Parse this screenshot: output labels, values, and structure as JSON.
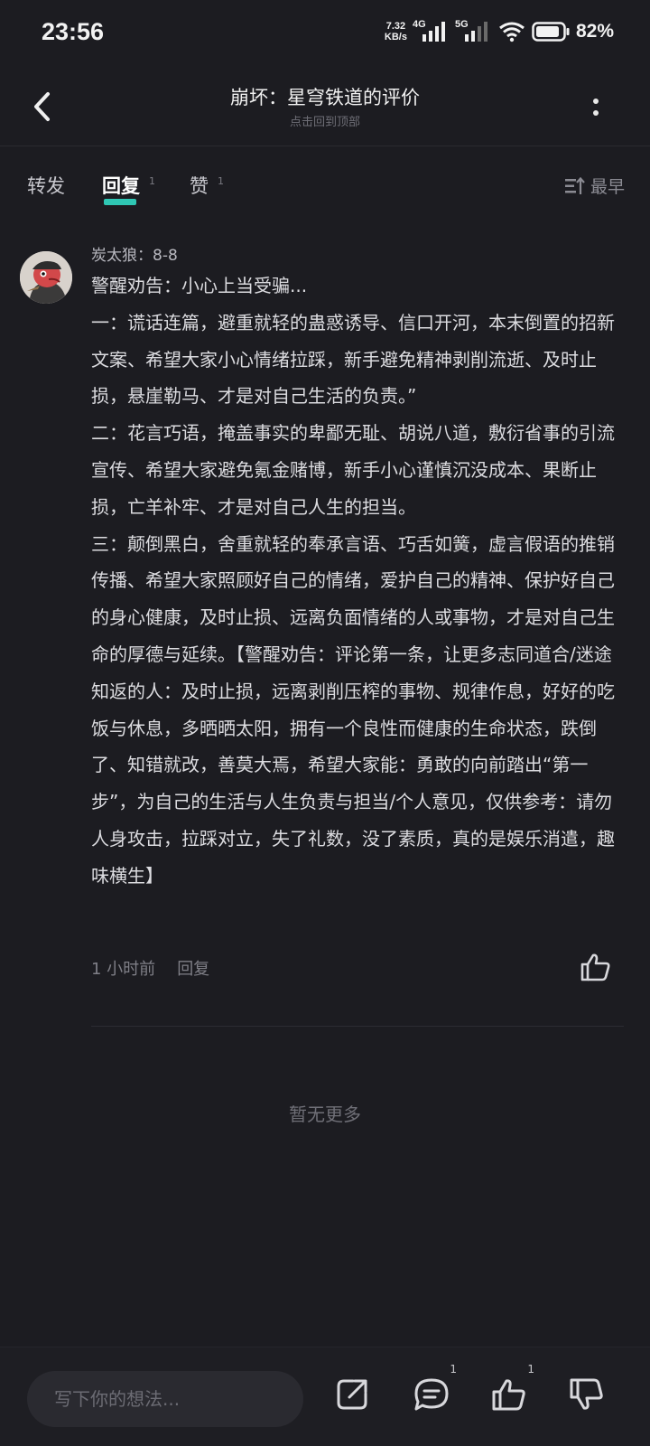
{
  "status_bar": {
    "time": "23:56",
    "net_speed_value": "7.32",
    "net_speed_unit": "KB/s",
    "sim1_label": "4G",
    "sim2_label": "5G",
    "battery": "82%"
  },
  "header": {
    "title": "崩坏：星穹铁道的评价",
    "subtitle": "点击回到顶部"
  },
  "tabs": [
    {
      "label": "转发",
      "count": ""
    },
    {
      "label": "回复",
      "count": "1"
    },
    {
      "label": "赞",
      "count": "1"
    }
  ],
  "sort_label": "最早",
  "comment": {
    "author": "炭太狼：8-8",
    "text": "警醒劝告：小心上当受骗...\n一：谎话连篇，避重就轻的蛊惑诱导、信口开河，本末倒置的招新文案、希望大家小心情绪拉踩，新手避免精神剥削流逝、及时止损，悬崖勒马、才是对自己生活的负责。”\n二：花言巧语，掩盖事实的卑鄙无耻、胡说八道，敷衍省事的引流宣传、希望大家避免氪金赌博，新手小心谨慎沉没成本、果断止损，亡羊补牢、才是对自己人生的担当。\n三：颠倒黑白，舍重就轻的奉承言语、巧舌如簧，虚言假语的推销传播、希望大家照顾好自己的情绪，爱护自己的精神、保护好自己的身心健康，及时止损、远离负面情绪的人或事物，才是对自己生命的厚德与延续。【警醒劝告：评论第一条，让更多志同道合/迷途知返的人：及时止损，远离剥削压榨的事物、规律作息，好好的吃饭与休息，多晒晒太阳，拥有一个良性而健康的生命状态，跌倒了、知错就改，善莫大焉，希望大家能：勇敢的向前踏出“第一步”，为自己的生活与人生负责与担当/个人意见，仅供参考：请勿人身攻击，拉踩对立，失了礼数，没了素质，真的是娱乐消遣，趣味横生】",
    "time": "1 小时前",
    "reply_label": "回复"
  },
  "no_more": "暂无更多",
  "bottom": {
    "input_placeholder": "写下你的想法...",
    "comment_count": "1",
    "like_count": "1"
  },
  "colors": {
    "background": "#1c1c21",
    "accent": "#2fc7b4",
    "text_primary": "#dcdce0",
    "text_muted": "#7f7f87"
  },
  "icons": [
    "back-arrow-icon",
    "more-vertical-icon",
    "sort-icon",
    "thumbs-up-icon",
    "share-icon",
    "comment-icon",
    "thumbs-down-icon"
  ]
}
